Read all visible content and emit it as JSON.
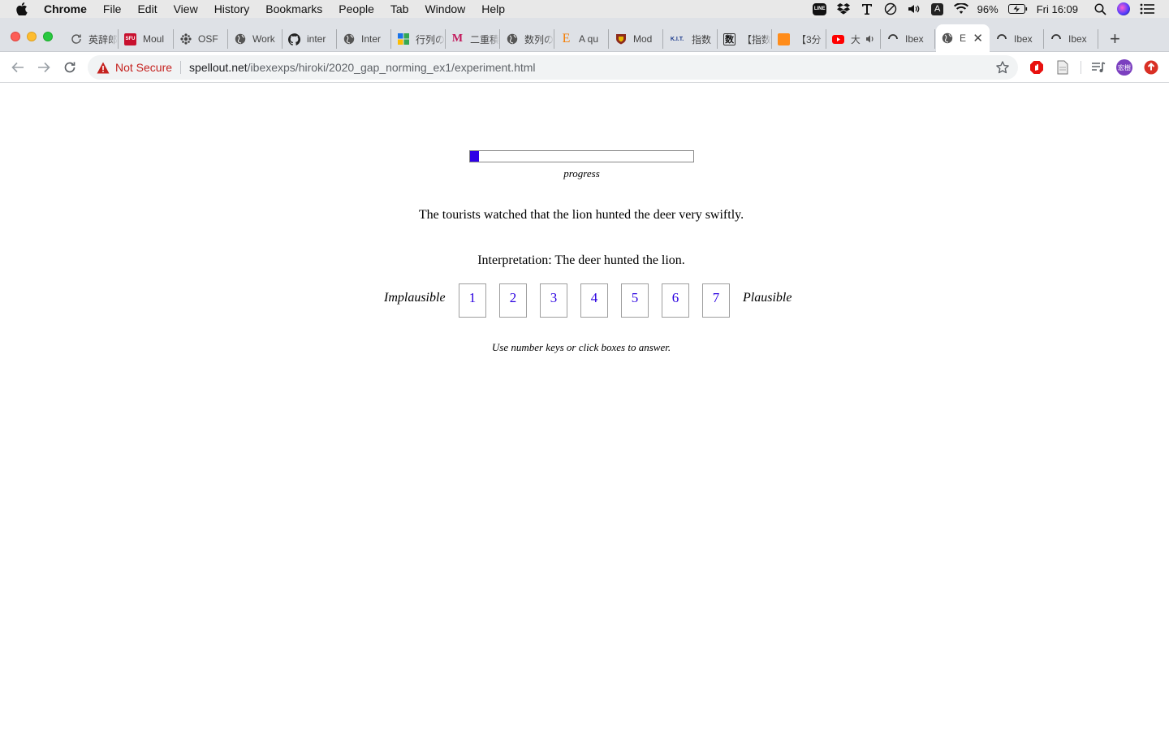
{
  "menubar": {
    "app_name": "Chrome",
    "items": [
      "File",
      "Edit",
      "View",
      "History",
      "Bookmarks",
      "People",
      "Tab",
      "Window",
      "Help"
    ],
    "line_badge": "LINE",
    "a_badge": "A",
    "battery": "96%",
    "clock": "Fri 16:09"
  },
  "tabs": [
    {
      "title": "英辞郎",
      "favicon": "sync-icon"
    },
    {
      "title": "Moul",
      "favicon": "sfu-icon",
      "favicon_text": "SFU"
    },
    {
      "title": "OSF",
      "favicon": "osf-icon"
    },
    {
      "title": "Work",
      "favicon": "globe-icon"
    },
    {
      "title": "inter",
      "favicon": "github-icon"
    },
    {
      "title": "Inter",
      "favicon": "globe-icon"
    },
    {
      "title": "行列の",
      "favicon": "grid-icon"
    },
    {
      "title": "二重積",
      "favicon": "m-icon",
      "favicon_text": "M"
    },
    {
      "title": "数列の",
      "favicon": "globe-icon"
    },
    {
      "title": "A qu",
      "favicon": "e-icon",
      "favicon_text": "E"
    },
    {
      "title": "Mod",
      "favicon": "shield-icon"
    },
    {
      "title": "指数",
      "favicon": "kit-icon",
      "favicon_text": "K.I.T."
    },
    {
      "title": "【指数",
      "favicon": "kanji-icon",
      "favicon_text": "数"
    },
    {
      "title": "【3分",
      "favicon": "orange-icon"
    },
    {
      "title": "大",
      "favicon": "youtube-icon"
    },
    {
      "title": "Ibex",
      "favicon": "loading-icon"
    },
    {
      "title": "E",
      "favicon": "globe-icon",
      "active": true
    },
    {
      "title": "Ibex",
      "favicon": "loading-icon"
    },
    {
      "title": "Ibex",
      "favicon": "loading-icon"
    }
  ],
  "toolbar": {
    "security_label": "Not Secure",
    "url_host": "spellout.net",
    "url_path": "/ibexexps/hiroki/2020_gap_norming_ex1/experiment.html",
    "profile_initials": "宏樹"
  },
  "experiment": {
    "progress_fraction": 0.04,
    "progress_label": "progress",
    "sentence": "The tourists watched that the lion hunted the deer very swiftly.",
    "interpretation": "Interpretation: The deer hunted the lion.",
    "scale_left_label": "Implausible",
    "scale_right_label": "Plausible",
    "scale_options": [
      "1",
      "2",
      "3",
      "4",
      "5",
      "6",
      "7"
    ],
    "instruction": "Use number keys or click boxes to answer."
  },
  "colors": {
    "accent_blue": "#2e00e6",
    "warning_red": "#c5221f"
  }
}
